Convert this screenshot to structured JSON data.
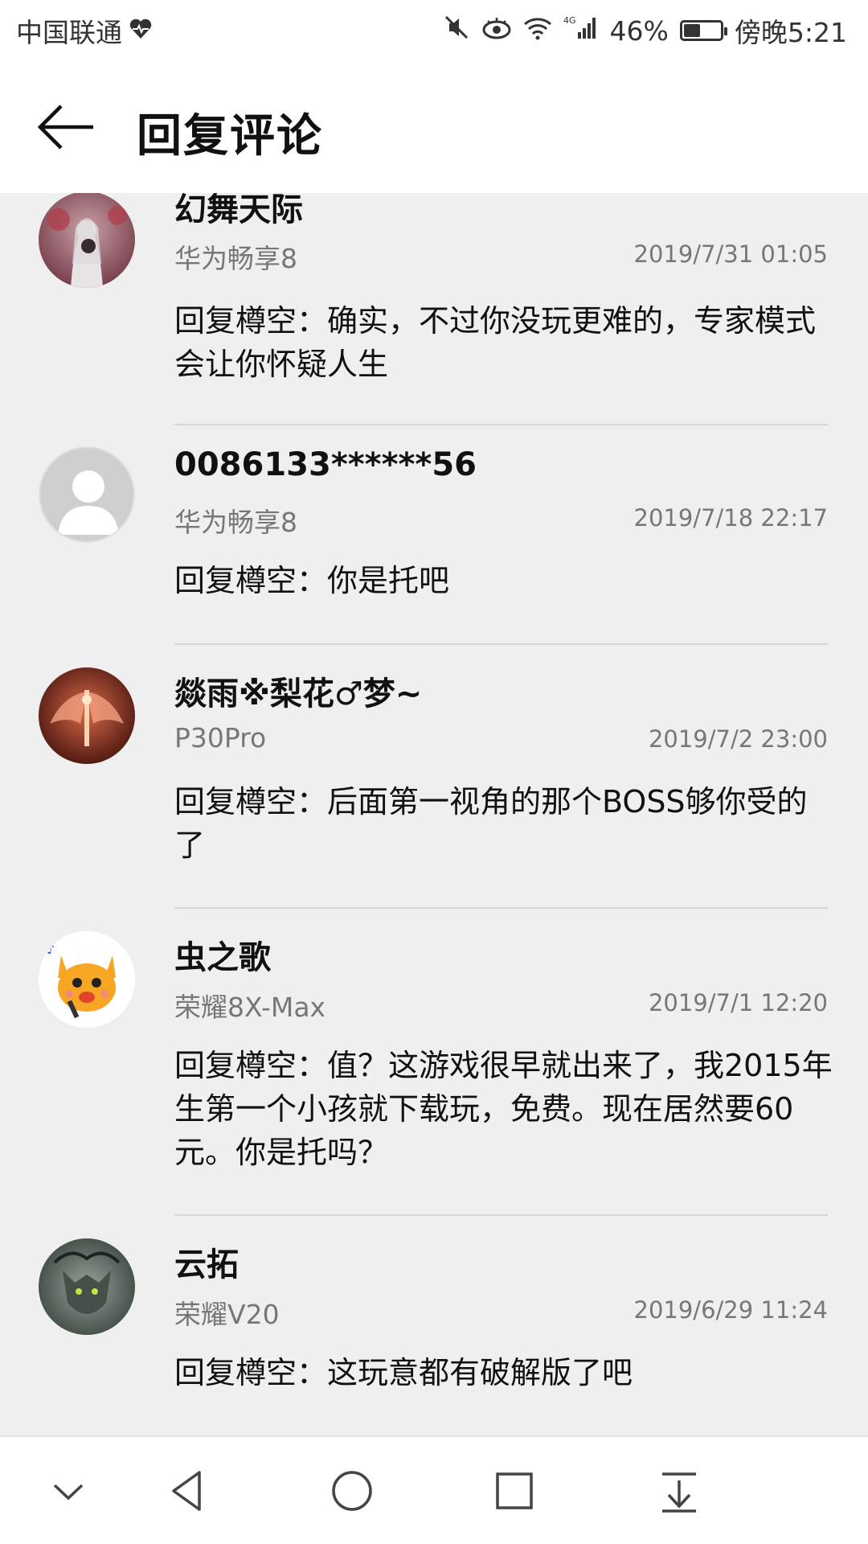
{
  "status_bar": {
    "carrier": "中国联通",
    "battery_percent": "46%",
    "time": "傍晚5:21",
    "network": "4G",
    "battery_level": 0.46,
    "icons": [
      "heart-rate-icon",
      "mute-icon",
      "eye-comfort-icon",
      "wifi-icon",
      "signal-icon",
      "battery-icon"
    ]
  },
  "header": {
    "title": "回复评论"
  },
  "comments": [
    {
      "name": "幻舞天际",
      "device": "华为畅享8",
      "time": "2019/7/31 01:05",
      "text": "回复樽空：确实，不过你没玩更难的，专家模式会让你怀疑人生",
      "avatar": "anime-girl-avatar"
    },
    {
      "name": "0086133******56",
      "device": "华为畅享8",
      "time": "2019/7/18 22:17",
      "text": "回复樽空：你是托吧",
      "avatar": "default-user-avatar"
    },
    {
      "name": "燚雨※梨花♂梦~",
      "device": "P30Pro",
      "time": "2019/7/2 23:00",
      "text": "回复樽空：后面第一视角的那个BOSS够你受的了",
      "avatar": "red-wings-avatar"
    },
    {
      "name": "虫之歌",
      "device": "荣耀8X-Max",
      "time": "2019/7/1 12:20",
      "text": "回复樽空：值？这游戏很早就出来了，我2015年生第一个小孩就下载玩，免费。现在居然要60元。你是托吗？",
      "avatar": "yellow-cat-avatar"
    },
    {
      "name": "云拓",
      "device": "荣耀V20",
      "time": "2019/6/29 11:24",
      "text": "回复樽空：这玩意都有破解版了吧",
      "avatar": "wolf-avatar"
    }
  ],
  "nav_bar": {
    "buttons": [
      "collapse-icon",
      "back-triangle-icon",
      "home-circle-icon",
      "recents-square-icon",
      "notification-pull-icon"
    ]
  },
  "colors": {
    "content_bg": "#efefef",
    "secondary_text": "#777777",
    "divider": "#d7d7d7"
  }
}
